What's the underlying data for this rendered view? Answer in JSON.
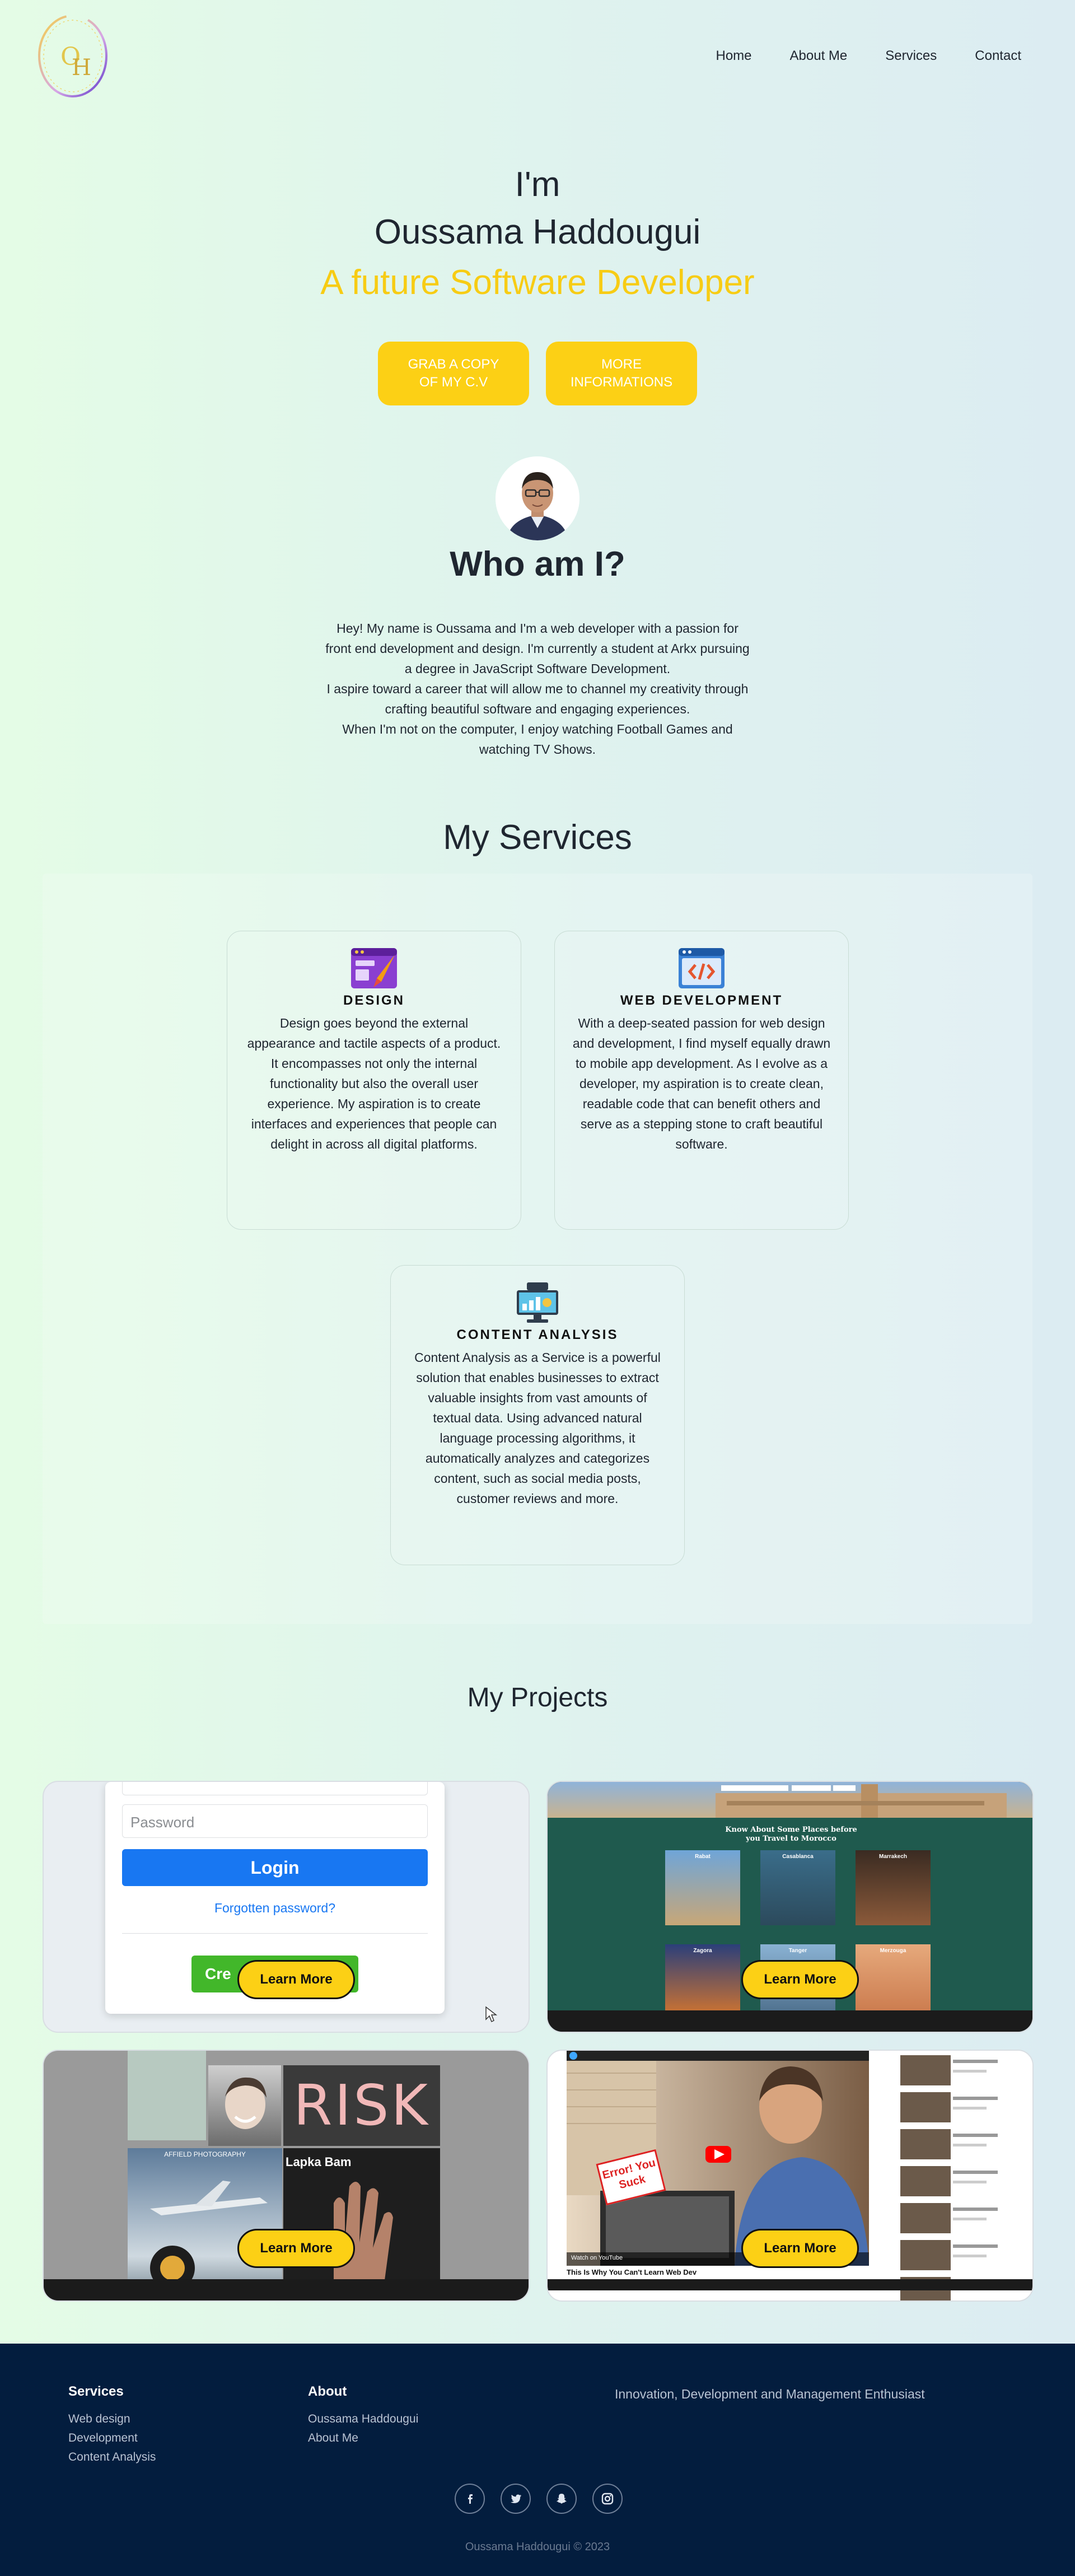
{
  "nav": {
    "items": [
      {
        "label": "Home"
      },
      {
        "label": "About Me"
      },
      {
        "label": "Services"
      },
      {
        "label": "Contact"
      }
    ]
  },
  "hero": {
    "intro": "I'm",
    "name": "Oussama Haddougui",
    "role": "A future Software Developer",
    "cv_button": "GRAB A COPY OF MY C.V",
    "info_button": "MORE INFORMATIONS"
  },
  "about": {
    "title": "Who am I?",
    "lines": [
      "Hey! My name is Oussama and I'm a web developer with a passion for front end development and design. I'm currently a student at Arkx pursuing a degree in JavaScript Software Development.",
      "I aspire toward a career that will allow me to channel my creativity through crafting beautiful software and engaging experiences.",
      "When I'm not on the computer, I enjoy watching Football Games and watching TV Shows."
    ]
  },
  "services": {
    "title": "My Services",
    "cards": [
      {
        "icon": "design-icon",
        "title": "DESIGN",
        "text": "Design goes beyond the external appearance and tactile aspects of a product. It encompasses not only the internal functionality but also the overall user experience. My aspiration is to create interfaces and experiences that people can delight in across all digital platforms."
      },
      {
        "icon": "code-icon",
        "title": "WEB DEVELOPMENT",
        "text": "With a deep-seated passion for web design and development, I find myself equally drawn to mobile app development. As I evolve as a developer, my aspiration is to create clean, readable code that can benefit others and serve as a stepping stone to craft beautiful software."
      },
      {
        "icon": "seo-analysis-icon",
        "title": "CONTENT ANALYSIS",
        "text": "Content Analysis as a Service is a powerful solution that enables businesses to extract valuable insights from vast amounts of textual data. Using advanced natural language processing algorithms, it automatically analyzes and categorizes content, such as social media posts, customer reviews and more."
      }
    ]
  },
  "projects": {
    "title": "My Projects",
    "learn_more": "Learn More",
    "login_preview": {
      "password_placeholder": "Password",
      "login_button": "Login",
      "forgot": "Forgotten password?",
      "create_button": "Cre"
    },
    "travel_preview": {
      "heading": "Know About Some Places before you Travel to Morocco",
      "places": [
        "Rabat",
        "Casablanca",
        "Marrakech",
        "Zagora",
        "Tanger",
        "Merzouga"
      ]
    },
    "gallery_preview": {
      "risk": "RISK",
      "caption": "Lapka Bam",
      "bottom": "AFFIELD PHOTOGRAPHY"
    },
    "video_preview": {
      "sign": "Error! You Suck",
      "caption": "This Is Why You Can't Learn Web Dev",
      "watch": "Watch on YouTube"
    }
  },
  "footer": {
    "services_title": "Services",
    "services_links": [
      "Web design",
      "Development",
      "Content Analysis"
    ],
    "about_title": "About",
    "about_links": [
      "Oussama Haddougui",
      "About Me"
    ],
    "tagline": "Innovation, Development and Management Enthusiast",
    "socials": [
      "facebook-icon",
      "twitter-icon",
      "snapchat-icon",
      "instagram-icon"
    ],
    "copyright": "Oussama Haddougui © 2023"
  },
  "colors": {
    "accent": "#fcd015",
    "heading": "#1f2630",
    "footer_bg": "#031d3e"
  }
}
